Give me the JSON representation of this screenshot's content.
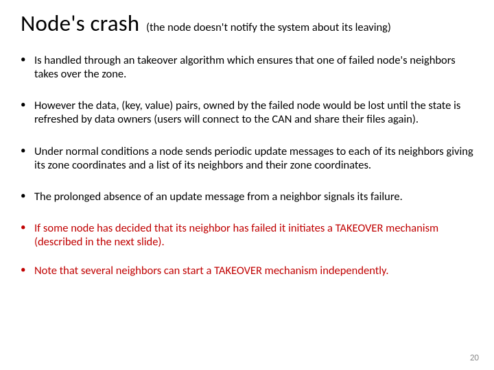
{
  "title": "Node's crash",
  "subtitle": "(the node doesn't notify the system about its leaving)",
  "bullets": {
    "b1": "Is handled through an takeover algorithm which ensures that one of failed node's neighbors takes over the zone.",
    "b2": "However the data, (key, value) pairs, owned by the failed node would be lost until the state is refreshed by data owners (users will connect to the CAN and share their files again).",
    "b3": "Under normal conditions a node sends periodic update messages to each of its neighbors giving its zone coordinates and a list of its neighbors and their zone coordinates.",
    "b4": "The prolonged absence of an update message from a neighbor signals its failure.",
    "b5": "If some node has decided that its neighbor has failed it initiates a TAKEOVER mechanism (described in the next slide).",
    "b6": "Note that several neighbors can start a TAKEOVER mechanism independently."
  },
  "page_number": "20"
}
